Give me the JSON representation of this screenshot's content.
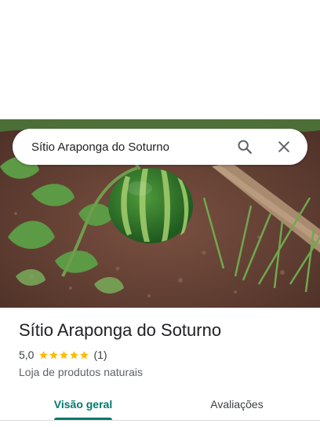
{
  "search": {
    "query": "Sítio Araponga do Soturno"
  },
  "place": {
    "name": "Sítio Araponga do Soturno",
    "rating": "5,0",
    "review_count": "(1)",
    "stars_filled": 5,
    "category": "Loja de produtos naturais"
  },
  "tabs": [
    {
      "label": "Visão geral",
      "active": true
    },
    {
      "label": "Avaliações",
      "active": false
    }
  ],
  "colors": {
    "accent": "#00796b",
    "star": "#fbbc04"
  }
}
